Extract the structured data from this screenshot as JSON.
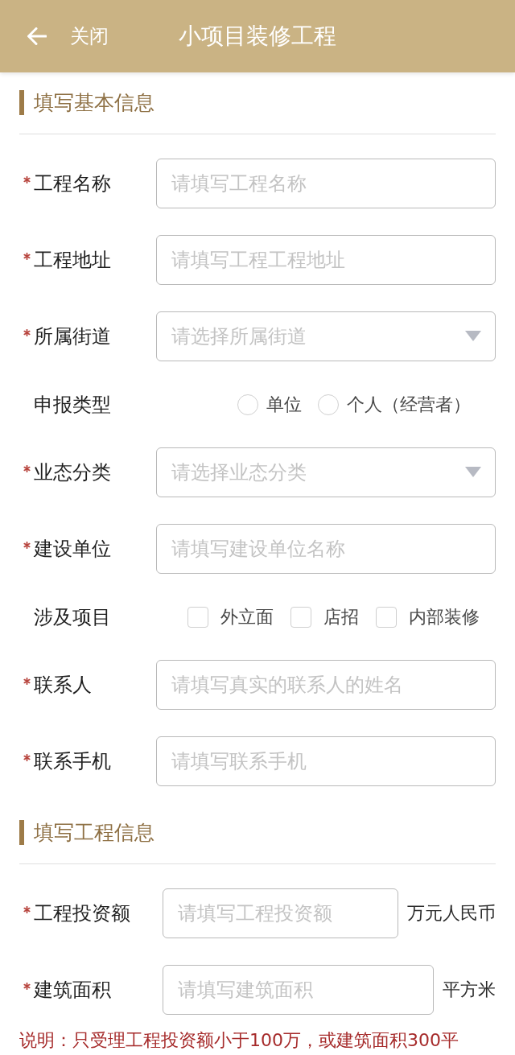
{
  "header": {
    "back_label": "关闭",
    "title": "小项目装修工程"
  },
  "sections": [
    {
      "title": "填写基本信息",
      "fields": [
        {
          "kind": "text",
          "label": "工程名称",
          "required": true,
          "placeholder": "请填写工程名称"
        },
        {
          "kind": "text",
          "label": "工程地址",
          "required": true,
          "placeholder": "请填写工程工程地址"
        },
        {
          "kind": "select",
          "label": "所属街道",
          "required": true,
          "placeholder": "请选择所属街道"
        },
        {
          "kind": "radio",
          "label": "申报类型",
          "required": false,
          "options": [
            {
              "label": "单位",
              "selected": false
            },
            {
              "label": "个人（经营者）",
              "selected": false
            }
          ]
        },
        {
          "kind": "select",
          "label": "业态分类",
          "required": true,
          "placeholder": "请选择业态分类"
        },
        {
          "kind": "text",
          "label": "建设单位",
          "required": true,
          "placeholder": "请填写建设单位名称"
        },
        {
          "kind": "checkbox",
          "label": "涉及项目",
          "required": false,
          "options": [
            {
              "label": "外立面",
              "checked": false
            },
            {
              "label": "店招",
              "checked": false
            },
            {
              "label": "内部装修",
              "checked": false
            }
          ]
        },
        {
          "kind": "text",
          "label": "联系人",
          "required": true,
          "placeholder": "请填写真实的联系人的姓名"
        },
        {
          "kind": "text",
          "label": "联系手机",
          "required": true,
          "placeholder": "请填写联系手机"
        }
      ]
    },
    {
      "title": "填写工程信息",
      "fields": [
        {
          "kind": "text",
          "label": "工程投资额",
          "required": true,
          "placeholder": "请填写工程投资额",
          "unit": "万元人民币"
        },
        {
          "kind": "text",
          "label": "建筑面积",
          "required": true,
          "placeholder": "请填写建筑面积",
          "unit": "平方米"
        }
      ],
      "note": "说明：只受理工程投资额小于100万，或建筑面积300平"
    }
  ]
}
